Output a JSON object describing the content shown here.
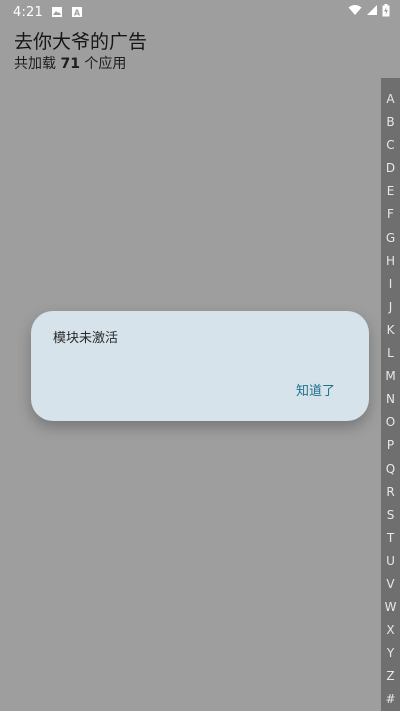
{
  "status_bar": {
    "time": "4:21",
    "left_icons": [
      "image-icon",
      "font-a-icon"
    ],
    "right_icons": [
      "wifi-icon",
      "cellular-signal-icon",
      "battery-charging-icon"
    ]
  },
  "header": {
    "title": "去你大爷的广告",
    "subtitle_prefix": "共加载",
    "subtitle_count": "71",
    "subtitle_suffix": "个应用"
  },
  "alphabet_index": [
    "A",
    "B",
    "C",
    "D",
    "E",
    "F",
    "G",
    "H",
    "I",
    "J",
    "K",
    "L",
    "M",
    "N",
    "O",
    "P",
    "Q",
    "R",
    "S",
    "T",
    "U",
    "V",
    "W",
    "X",
    "Y",
    "Z",
    "#"
  ],
  "dialog": {
    "message": "模块未激活",
    "confirm_label": "知道了"
  },
  "colors": {
    "background": "#9e9e9e",
    "index_bar": "#6f6f6f",
    "dialog_bg": "#d6e3ea",
    "dialog_button": "#1f6f8e"
  }
}
